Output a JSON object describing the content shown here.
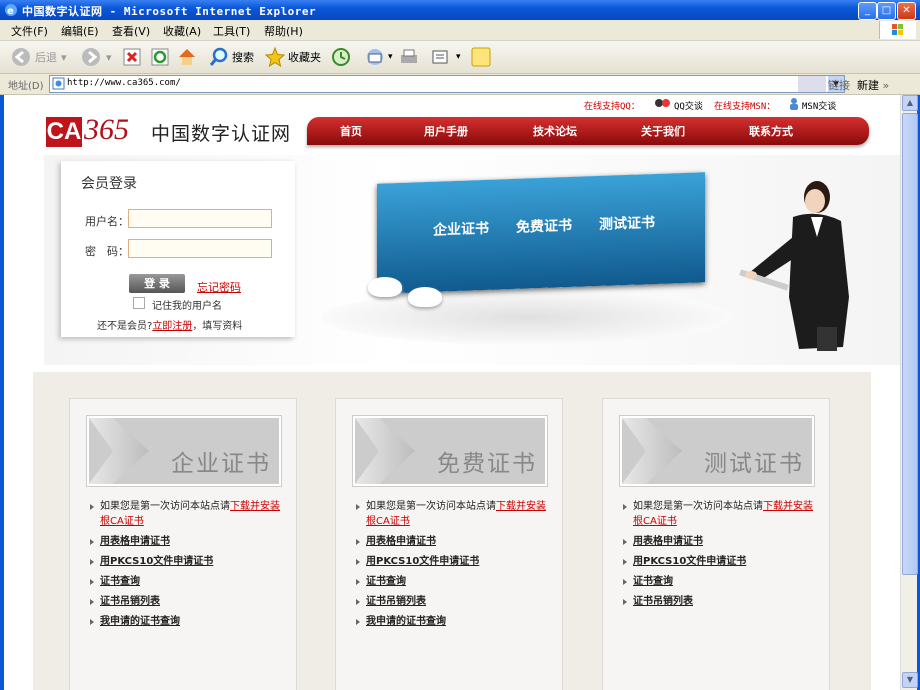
{
  "window": {
    "title": "中国数字认证网 - Microsoft Internet Explorer"
  },
  "menu": [
    "文件(F)",
    "编辑(E)",
    "查看(V)",
    "收藏(A)",
    "工具(T)",
    "帮助(H)"
  ],
  "toolbar": {
    "back": "后退",
    "search": "搜索",
    "favorites": "收藏夹"
  },
  "address": {
    "label": "地址(D)",
    "url": "http://www.ca365.com/",
    "links": "链接",
    "newlink": "新建"
  },
  "support": {
    "qq_label": "在线支持QQ：",
    "qq_chat": "QQ交谈",
    "msn_label": "在线支持MSN：",
    "msn_chat": "MSN交谈"
  },
  "logo": {
    "ca": "CA",
    "num": "365"
  },
  "site_name": "中国数字认证网",
  "nav": [
    "首页",
    "用户手册",
    "技术论坛",
    "关于我们",
    "联系方式"
  ],
  "banner": {
    "certs": [
      "企业证书",
      "免费证书",
      "测试证书"
    ]
  },
  "login": {
    "title": "会员登录",
    "username_label": "用户名：",
    "password_label": "密　码：",
    "button": "登 录",
    "forgot": "忘记密码",
    "remember": "记住我的用户名",
    "not_member": "还不是会员?",
    "register": "立即注册",
    "fill_info": "，填写资料"
  },
  "cards": [
    {
      "title": "企业证书",
      "intro": "如果您是第一次访问本站点请",
      "intro_link": "下载并安装根CA证书",
      "links": [
        "用表格申请证书",
        "用PKCS10文件申请证书",
        "证书查询",
        "证书吊销列表",
        "我申请的证书查询"
      ]
    },
    {
      "title": "免费证书",
      "intro": "如果您是第一次访问本站点请",
      "intro_link": "下载并安装根CA证书",
      "links": [
        "用表格申请证书",
        "用PKCS10文件申请证书",
        "证书查询",
        "证书吊销列表",
        "我申请的证书查询"
      ]
    },
    {
      "title": "测试证书",
      "intro": "如果您是第一次访问本站点请",
      "intro_link": "下载并安装根CA证书",
      "links": [
        "用表格申请证书",
        "用PKCS10文件申请证书",
        "证书查询",
        "证书吊销列表"
      ]
    }
  ]
}
